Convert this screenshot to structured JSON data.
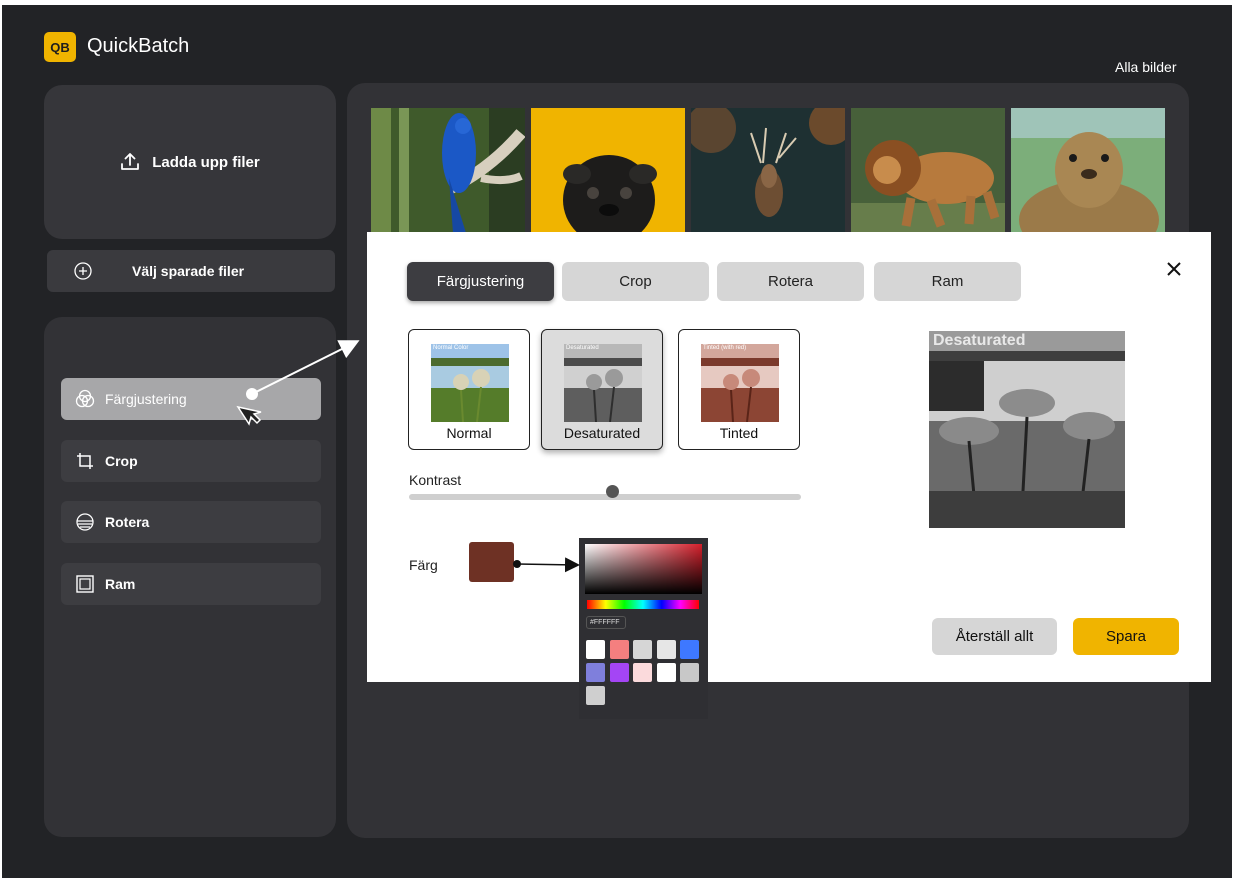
{
  "app": {
    "logo": "QB",
    "name": "QuickBatch",
    "filter_label": "Alla bilder"
  },
  "sidebar": {
    "upload_label": "Ladda upp filer",
    "saved_label": "Välj sparade filer",
    "tools": [
      {
        "label": "Färgjustering",
        "icon": "color-circles-icon",
        "active": true
      },
      {
        "label": "Crop",
        "icon": "crop-icon"
      },
      {
        "label": "Rotera",
        "icon": "rotate-icon"
      },
      {
        "label": "Ram",
        "icon": "frame-icon"
      }
    ]
  },
  "gallery": [
    "parrot",
    "pug",
    "deer",
    "lion",
    "marmot"
  ],
  "modal": {
    "tabs": [
      {
        "label": "Färgjustering",
        "active": true
      },
      {
        "label": "Crop"
      },
      {
        "label": "Rotera"
      },
      {
        "label": "Ram"
      }
    ],
    "presets": [
      {
        "label": "Normal",
        "caption": "Normal Color"
      },
      {
        "label": "Desaturated",
        "caption": "Desaturated",
        "selected": true
      },
      {
        "label": "Tinted",
        "caption": "Tinted (with red)"
      }
    ],
    "contrast_label": "Kontrast",
    "contrast_value": 0.52,
    "color_label": "Färg",
    "color_value": "#6e3124",
    "preview_title": "Desaturated",
    "reset_label": "Återställ allt",
    "save_label": "Spara"
  },
  "color_picker": {
    "hex_value": "#FFFFFF",
    "swatches": [
      "#ffffff",
      "#f47f7f",
      "#d6d6d6",
      "#e6e6e6",
      "#3e78ff",
      "#7f7fdc",
      "#a445f5",
      "#fbdadc",
      "#ffffff",
      "#c8c8c8",
      "#cfcfcf"
    ]
  },
  "colors": {
    "accent": "#f0b400",
    "background": "#222326",
    "panel": "#323236"
  }
}
